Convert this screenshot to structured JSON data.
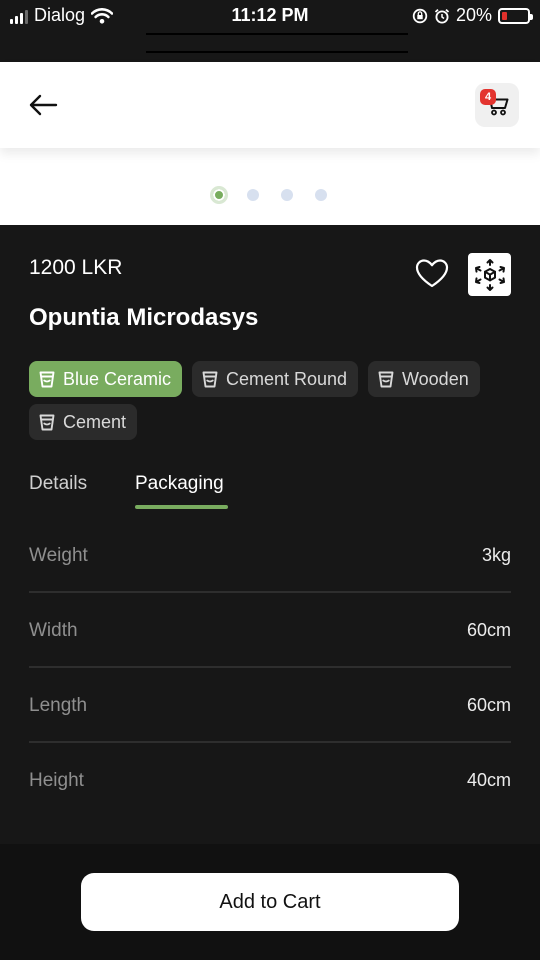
{
  "status_bar": {
    "carrier": "Dialog",
    "time": "11:12 PM",
    "battery_percent": "20%",
    "battery_level": 0.2,
    "icons": [
      "signal-icon",
      "wifi-icon",
      "screen-lock-icon",
      "alarm-icon",
      "battery-icon"
    ]
  },
  "header": {
    "cart_count": "4",
    "icons": [
      "back-arrow-icon",
      "cart-icon"
    ]
  },
  "carousel": {
    "total": 4,
    "active_index": 0
  },
  "product": {
    "price": "1200 LKR",
    "name": "Opuntia Microdasys",
    "icons": [
      "heart-icon",
      "ar-view-icon"
    ]
  },
  "pot_options": [
    {
      "label": "Blue Ceramic",
      "selected": true
    },
    {
      "label": "Cement Round",
      "selected": false
    },
    {
      "label": "Wooden",
      "selected": false
    },
    {
      "label": "Cement",
      "selected": false
    }
  ],
  "tabs": [
    {
      "label": "Details",
      "active": false
    },
    {
      "label": "Packaging",
      "active": true
    }
  ],
  "packaging": [
    {
      "label": "Weight",
      "value": "3kg"
    },
    {
      "label": "Width",
      "value": "60cm"
    },
    {
      "label": "Length",
      "value": "60cm"
    },
    {
      "label": "Height",
      "value": "40cm"
    }
  ],
  "actions": {
    "add_to_cart": "Add to Cart"
  },
  "colors": {
    "accent": "#79ac5f",
    "background": "#171717",
    "badge": "#e3342f"
  }
}
